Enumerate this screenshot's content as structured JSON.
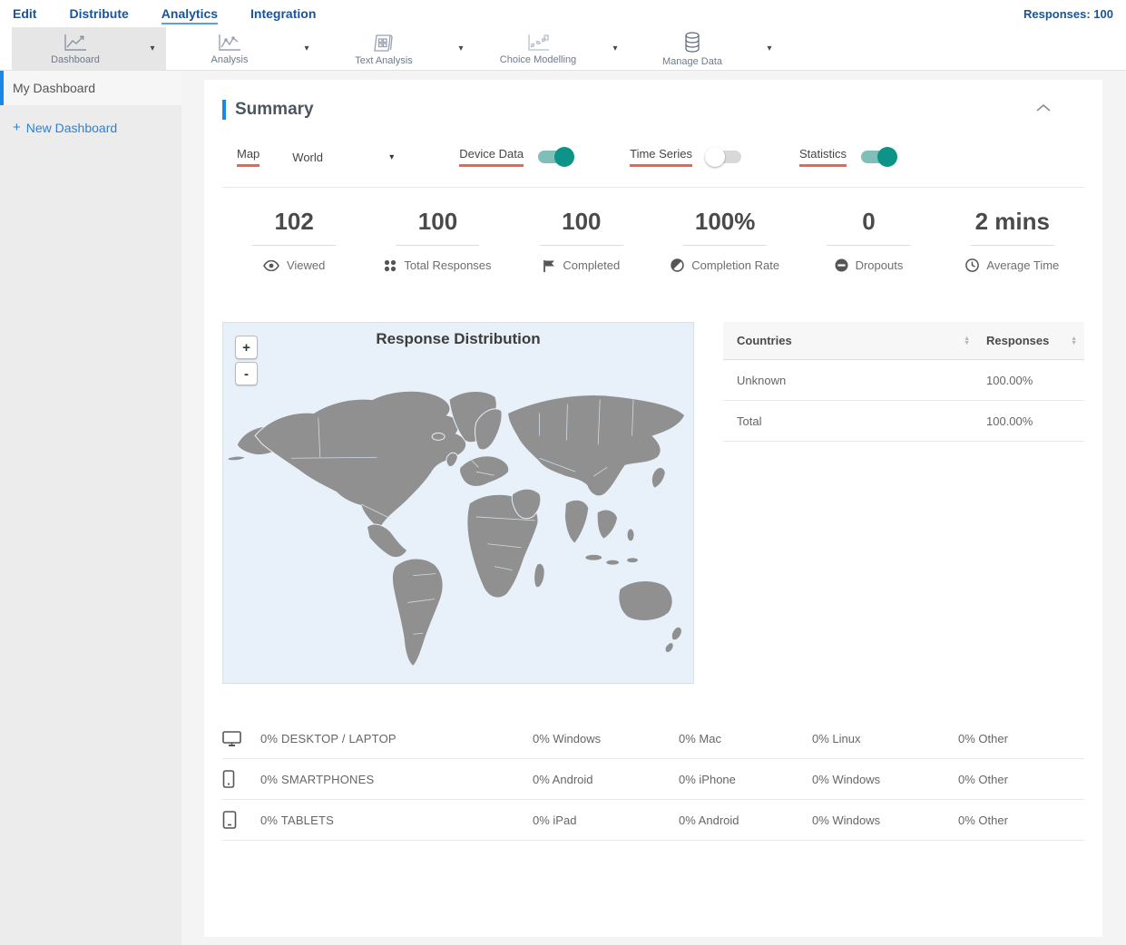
{
  "topnav": {
    "items": [
      {
        "label": "Edit"
      },
      {
        "label": "Distribute"
      },
      {
        "label": "Analytics"
      },
      {
        "label": "Integration"
      }
    ],
    "responses_label": "Responses: 100"
  },
  "toolbar": {
    "items": [
      {
        "label": "Dashboard"
      },
      {
        "label": "Analysis"
      },
      {
        "label": "Text Analysis"
      },
      {
        "label": "Choice Modelling"
      },
      {
        "label": "Manage Data"
      }
    ],
    "caret": "▾"
  },
  "sidebar": {
    "active_item": "My Dashboard",
    "new_dashboard_label": "New Dashboard",
    "plus": "+"
  },
  "summary": {
    "title": "Summary",
    "controls": {
      "map_label": "Map",
      "map_value": "World",
      "map_caret": "▾",
      "device_data_label": "Device Data",
      "time_series_label": "Time Series",
      "statistics_label": "Statistics"
    },
    "stats": [
      {
        "value": "102",
        "label": "Viewed"
      },
      {
        "value": "100",
        "label": "Total Responses"
      },
      {
        "value": "100",
        "label": "Completed"
      },
      {
        "value": "100%",
        "label": "Completion Rate"
      },
      {
        "value": "0",
        "label": "Dropouts"
      },
      {
        "value": "2 mins",
        "label": "Average Time"
      }
    ],
    "map": {
      "title": "Response Distribution",
      "zoom_in": "+",
      "zoom_out": "-"
    },
    "countries_table": {
      "col_countries": "Countries",
      "col_responses": "Responses",
      "sort_up": "▲",
      "sort_down": "▼",
      "rows": [
        {
          "country": "Unknown",
          "responses": "100.00%"
        },
        {
          "country": "Total",
          "responses": "100.00%"
        }
      ]
    },
    "devices": [
      {
        "label": "0% DESKTOP / LAPTOP",
        "cells": [
          "0% Windows",
          "0% Mac",
          "0% Linux",
          "0% Other"
        ]
      },
      {
        "label": "0% SMARTPHONES",
        "cells": [
          "0% Android",
          "0% iPhone",
          "0% Windows",
          "0% Other"
        ]
      },
      {
        "label": "0% TABLETS",
        "cells": [
          "0% iPad",
          "0% Android",
          "0% Windows",
          "0% Other"
        ]
      }
    ]
  },
  "colors": {
    "brand_blue": "#1b87e6",
    "nav_navy": "#17549c",
    "toggle_on": "#0d9488",
    "highlight_red": "#ee6352",
    "map_land": "#909090",
    "map_sea": "#e8f1f9"
  }
}
